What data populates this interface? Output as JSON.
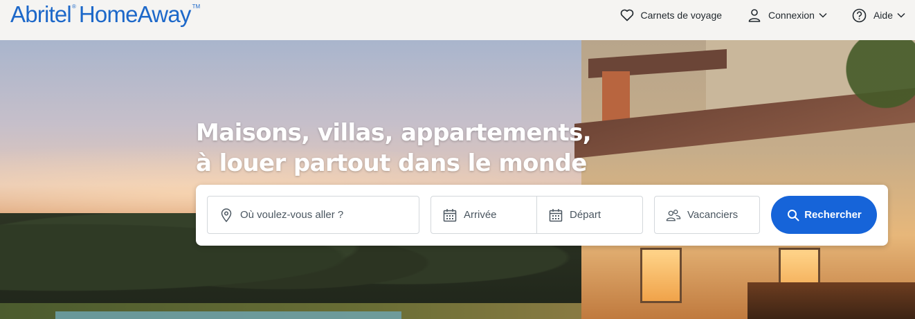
{
  "brand": {
    "name_part1": "Abritel",
    "name_sup": "®",
    "name_part2": "HomeAway",
    "name_tm": "TM"
  },
  "nav": {
    "items": [
      {
        "label": "Carnets de voyage",
        "icon": "heart-icon",
        "has_chevron": false
      },
      {
        "label": "Connexion",
        "icon": "user-icon",
        "has_chevron": true
      },
      {
        "label": "Aide",
        "icon": "help-icon",
        "has_chevron": true
      }
    ]
  },
  "hero": {
    "headline_line1": "Maisons, villas, appartements,",
    "headline_line2": "à louer partout dans le monde"
  },
  "search": {
    "destination_placeholder": "Où voulez-vous aller ?",
    "arrival_placeholder": "Arrivée",
    "departure_placeholder": "Départ",
    "guests_placeholder": "Vacanciers",
    "button_label": "Rechercher"
  },
  "colors": {
    "brand_blue": "#1d68c9",
    "button_blue": "#1664d9",
    "header_bg": "#f5f4f2",
    "text_dark": "#22292f"
  }
}
